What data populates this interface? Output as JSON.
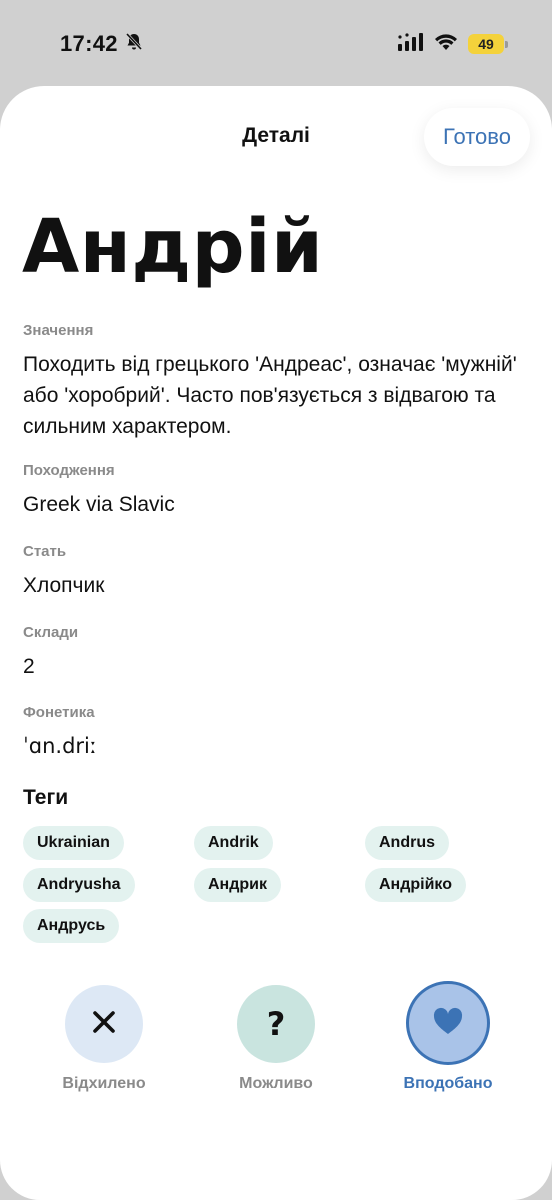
{
  "status_bar": {
    "time": "17:42",
    "battery": "49"
  },
  "header": {
    "title": "Деталі",
    "done_label": "Готово"
  },
  "name": "Андрій",
  "fields": {
    "meaning": {
      "label": "Значення",
      "value": "Походить від грецького 'Андреас', означає 'мужній' або 'хоробрий'. Часто пов'язується з відвагою та сильним характером."
    },
    "origin": {
      "label": "Походження",
      "value": "Greek via Slavic"
    },
    "gender": {
      "label": "Стать",
      "value": "Хлопчик"
    },
    "syllables": {
      "label": "Склади",
      "value": "2"
    },
    "phonetics": {
      "label": "Фонетика",
      "value": "ˈɑn.driː"
    }
  },
  "tags": {
    "title": "Теги",
    "items": [
      "Ukrainian",
      "Andrik",
      "Andrus",
      "Andryusha",
      "Андрик",
      "Андрійко",
      "Андрусь"
    ]
  },
  "actions": {
    "reject": {
      "label": "Відхилено",
      "icon": "close-icon"
    },
    "maybe": {
      "label": "Можливо",
      "icon": "question-icon"
    },
    "like": {
      "label": "Вподобано",
      "icon": "heart-icon"
    }
  },
  "colors": {
    "accent": "#3c73b5",
    "tag_bg": "#e3f2ef",
    "reject_bg": "#dde8f5",
    "maybe_bg": "#c9e4df",
    "like_bg": "#a9c3e8"
  }
}
